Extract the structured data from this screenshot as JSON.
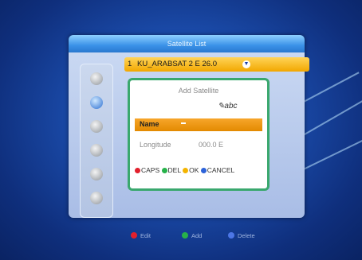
{
  "window": {
    "title": "Satellite List"
  },
  "satellite_selector": {
    "index": "1",
    "name": "KU_ARABSAT 2 E 26.0"
  },
  "dialog": {
    "title": "Add Satellite",
    "input_mode": "abc",
    "name_label": "Name",
    "longitude_label": "Longitude",
    "longitude_value": "000.0 E"
  },
  "dialog_keys": [
    {
      "label": "CAPS",
      "color": "#e2202d"
    },
    {
      "label": "DEL",
      "color": "#27b24a"
    },
    {
      "label": "OK",
      "color": "#f4b400"
    },
    {
      "label": "CANCEL",
      "color": "#2d63d9"
    }
  ],
  "footer": {
    "edit_label": "Edit",
    "add_label": "Add",
    "delete_label": "Delete",
    "edit_color": "#e2202d",
    "add_color": "#27b24a",
    "delete_color": "#4c76e6"
  },
  "side_icons": [
    "tv-icon",
    "satellite-dish-icon",
    "globe-icon",
    "lock-icon",
    "tools-icon",
    "settings-icon"
  ]
}
